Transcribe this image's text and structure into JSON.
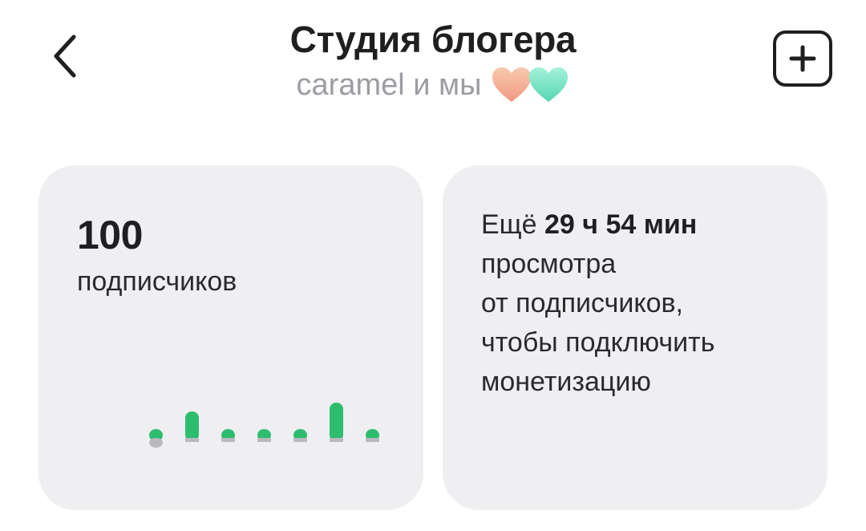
{
  "header": {
    "title": "Студия блогера",
    "subtitle": "caramel и мы",
    "back_icon": "chevron-left-icon",
    "add_icon": "plus-square-icon",
    "hearts": [
      "#f4b89c",
      "#7fe3c4"
    ]
  },
  "subscribers_card": {
    "count": "100",
    "label": "подписчиков",
    "chart_data": {
      "type": "bar",
      "values": [
        1,
        3,
        1,
        1,
        1,
        4,
        1
      ],
      "negative_marker_index": 0,
      "colors": {
        "bar": "#2dbd6e",
        "baseline": "#b9b9bd"
      }
    }
  },
  "monetization_card": {
    "prefix": "Ещё ",
    "time": "29 ч 54 мин",
    "line2": "просмотра",
    "line3": "от подписчиков,",
    "line4": "чтобы подключить",
    "line5": "монетизацию"
  }
}
